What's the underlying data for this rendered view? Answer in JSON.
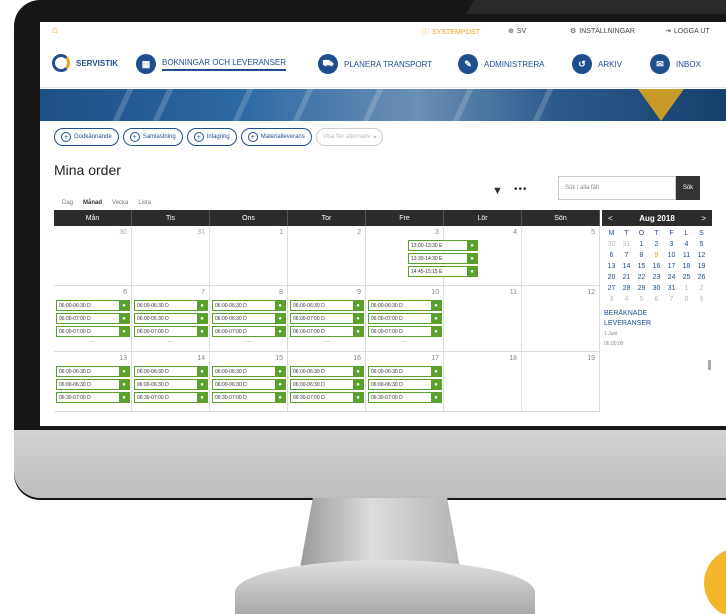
{
  "topbar": {
    "items": [
      {
        "label": "SYSTEMPOST"
      },
      {
        "label": "SV"
      },
      {
        "label": "INSTÄLLNINGAR"
      },
      {
        "label": "LOGGA UT"
      }
    ]
  },
  "nav": {
    "logo": "SERVISTIK",
    "items": [
      {
        "label": "BOKNINGAR OCH LEVERANSER",
        "icon": "calendar-icon"
      },
      {
        "label": "PLANERA TRANSPORT",
        "icon": "truck-icon"
      },
      {
        "label": "ADMINISTRERA",
        "icon": "pencil-icon"
      },
      {
        "label": "ARKIV",
        "icon": "history-icon"
      },
      {
        "label": "INBOX",
        "icon": "mail-icon"
      }
    ]
  },
  "filters": [
    {
      "label": "Godkännande"
    },
    {
      "label": "Samlastning"
    },
    {
      "label": "Inlagring"
    },
    {
      "label": "Materialleverans"
    },
    {
      "label": "Visa fler alternativ",
      "muted": true
    }
  ],
  "page": {
    "title": "Mina order",
    "views": [
      "Dag",
      "Månad",
      "Vecka",
      "Lista"
    ],
    "active_view": "Månad",
    "search_placeholder": "Sök i alla fält",
    "search_button": "Sök"
  },
  "calendar": {
    "weekdays": [
      "Mån",
      "Tis",
      "Ons",
      "Tor",
      "Fre",
      "Lör",
      "Sön"
    ],
    "weeks": [
      {
        "days": [
          {
            "num": "30",
            "other": true,
            "events": []
          },
          {
            "num": "31",
            "other": true,
            "events": []
          },
          {
            "num": "1",
            "events": []
          },
          {
            "num": "2",
            "events": []
          },
          {
            "num": "3",
            "events": [
              "13:00-13:30 E",
              "13:30-14:30 E",
              "14:45-15:15 E"
            ],
            "narrow": true
          },
          {
            "num": "4",
            "events": []
          },
          {
            "num": "5",
            "events": []
          }
        ]
      },
      {
        "days": [
          {
            "num": "6",
            "events": [
              "06:00-06:30 D",
              "06:00-07:00 D",
              "06:00-07:00 D"
            ],
            "more": true
          },
          {
            "num": "7",
            "events": [
              "06:00-06:30 D",
              "06:00-06:30 D",
              "06:00-07:00 D"
            ],
            "more": true
          },
          {
            "num": "8",
            "events": [
              "06:00-06:30 D",
              "06:00-06:30 D",
              "06:00-07:00 D"
            ],
            "more": true
          },
          {
            "num": "9",
            "events": [
              "06:00-06:30 D",
              "06:00-07:00 D",
              "06:00-07:00 D"
            ],
            "more": true
          },
          {
            "num": "10",
            "events": [
              "06:00-06:30 D",
              "06:00-07:00 D",
              "06:00-07:00 D"
            ],
            "more": true
          },
          {
            "num": "11",
            "events": []
          },
          {
            "num": "12",
            "events": []
          }
        ]
      },
      {
        "days": [
          {
            "num": "13",
            "events": [
              "06:00-06:30 D",
              "06:00-06:30 D",
              "06:30-07:00 D"
            ]
          },
          {
            "num": "14",
            "events": [
              "06:00-06:30 D",
              "06:00-06:30 D",
              "06:30-07:00 D"
            ]
          },
          {
            "num": "15",
            "events": [
              "06:00-06:30 D",
              "06:00-06:30 D",
              "06:30-07:00 D"
            ]
          },
          {
            "num": "16",
            "events": [
              "06:00-06:30 D",
              "06:00-06:30 D",
              "06:30-07:00 D"
            ]
          },
          {
            "num": "17",
            "events": [
              "06:00-06:30 D",
              "06:00-06:30 D",
              "06:30-07:00 D"
            ]
          },
          {
            "num": "18",
            "events": []
          },
          {
            "num": "19",
            "events": []
          }
        ]
      }
    ]
  },
  "mini": {
    "month": "Aug 2018",
    "prev": "<",
    "next": ">",
    "headers": [
      "M",
      "T",
      "O",
      "T",
      "F",
      "L",
      "S"
    ],
    "rows": [
      [
        "30",
        "31",
        "1",
        "2",
        "3",
        "4",
        "5"
      ],
      [
        "6",
        "7",
        "8",
        "9",
        "10",
        "11",
        "12"
      ],
      [
        "13",
        "14",
        "15",
        "16",
        "17",
        "18",
        "19"
      ],
      [
        "20",
        "21",
        "22",
        "23",
        "24",
        "25",
        "26"
      ],
      [
        "27",
        "28",
        "29",
        "30",
        "31",
        "1",
        "2"
      ],
      [
        "3",
        "4",
        "5",
        "6",
        "7",
        "8",
        "9"
      ]
    ],
    "section1": "BERÄKNADE",
    "section2": "LEVERANSER",
    "sub1": "1 Juni",
    "sub2": "06:00:00"
  }
}
